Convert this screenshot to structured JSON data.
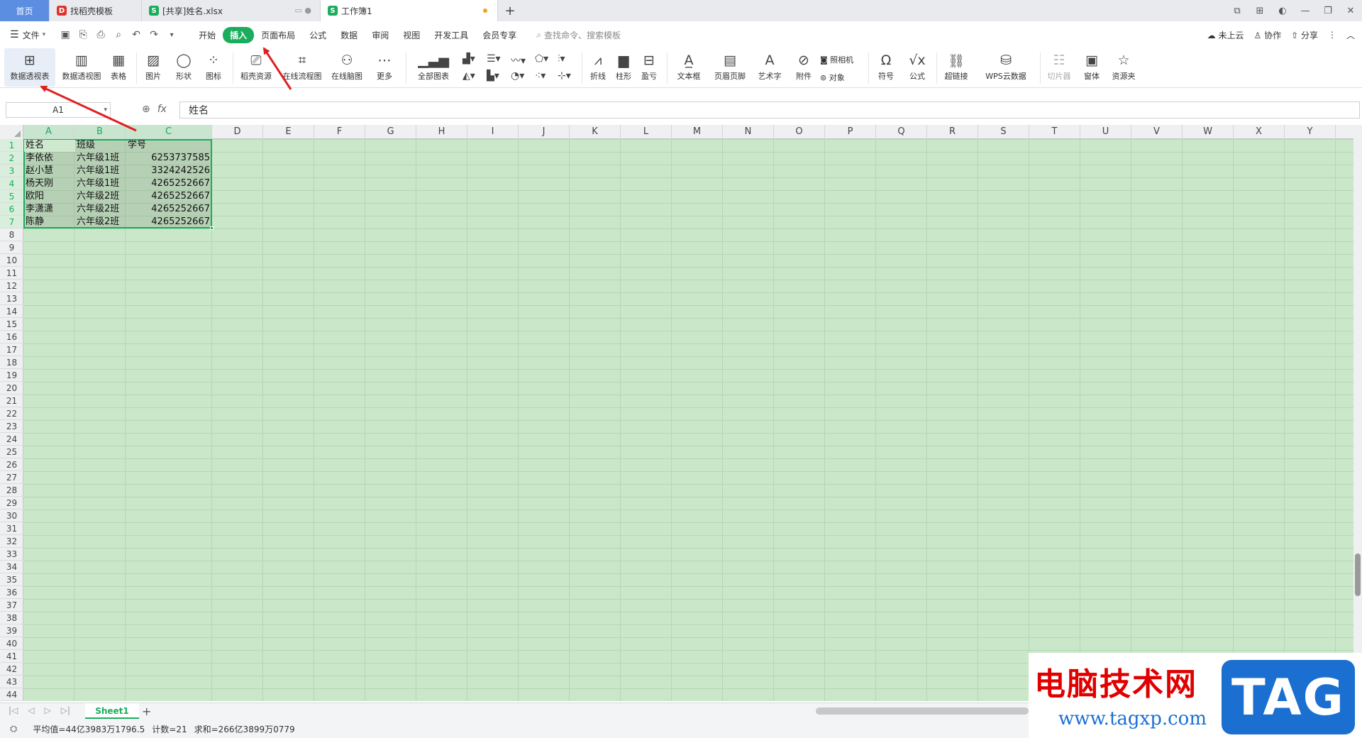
{
  "tabs": {
    "home": "首页",
    "t1": "找稻壳模板",
    "t2": "[共享]姓名.xlsx",
    "t3": "工作簿1",
    "new": "+"
  },
  "window_controls": [
    "⧉",
    "⊞",
    "◐",
    "—",
    "❐",
    "✕"
  ],
  "menubar": {
    "file": "文件",
    "menus": [
      "开始",
      "插入",
      "页面布局",
      "公式",
      "数据",
      "审阅",
      "视图",
      "开发工具",
      "会员专享"
    ],
    "active_menu": "插入",
    "search": "查找命令、搜索模板",
    "cloud": "未上云",
    "collab": "协作",
    "share": "分享"
  },
  "ribbon": {
    "pivot_table": "数据透视表",
    "pivot_chart": "数据透视图",
    "table": "表格",
    "picture": "图片",
    "shape": "形状",
    "icon": "图标",
    "docer": "稻壳资源",
    "flowchart": "在线流程图",
    "mindmap": "在线脑图",
    "more": "更多",
    "all_charts": "全部图表",
    "line": "折线",
    "column": "柱形",
    "winloss": "盈亏",
    "textbox": "文本框",
    "header_footer": "页眉页脚",
    "wordart": "艺术字",
    "attachment": "附件",
    "camera": "照相机",
    "object": "对象",
    "symbol": "符号",
    "formula": "公式",
    "hyperlink": "超链接",
    "wps_cloud": "WPS云数据",
    "slicer": "切片器",
    "window": "窗体",
    "resource": "资源夹"
  },
  "formula_bar": {
    "name_box": "A1",
    "content": "姓名"
  },
  "columns": [
    "A",
    "B",
    "C",
    "D",
    "E",
    "F",
    "G",
    "H",
    "I",
    "J",
    "K",
    "L",
    "M",
    "N",
    "O",
    "P",
    "Q",
    "R",
    "S",
    "T",
    "U",
    "V",
    "W",
    "X",
    "Y"
  ],
  "rows": [
    "1",
    "2",
    "3",
    "4",
    "5",
    "6",
    "7",
    "8",
    "9",
    "10",
    "11",
    "12",
    "13",
    "14",
    "15",
    "16",
    "17",
    "18",
    "19",
    "20",
    "21",
    "22",
    "23",
    "24",
    "25",
    "26",
    "27",
    "28",
    "29",
    "30",
    "31",
    "32",
    "33",
    "34",
    "35",
    "36",
    "37",
    "38",
    "39",
    "40",
    "41",
    "42",
    "43",
    "44"
  ],
  "sheet": {
    "header": [
      "姓名",
      "班级",
      "学号"
    ],
    "data": [
      [
        "李依依",
        "六年级1班",
        "6253737585"
      ],
      [
        "赵小慧",
        "六年级1班",
        "3324242526"
      ],
      [
        "杨天刚",
        "六年级1班",
        "4265252667"
      ],
      [
        "欧阳",
        "六年级2班",
        "4265252667"
      ],
      [
        "李潇潇",
        "六年级2班",
        "4265252667"
      ],
      [
        "陈静",
        "六年级2班",
        "4265252667"
      ]
    ]
  },
  "sheet_tabs": {
    "active": "Sheet1",
    "add": "+"
  },
  "status": {
    "average": "平均值=44亿3983万1796.5",
    "count": "计数=21",
    "sum": "求和=266亿3899万0779"
  },
  "watermark": {
    "title": "电脑技术网",
    "url": "www.tagxp.com",
    "logo": "TAG"
  },
  "colors": {
    "accent": "#1aad5d",
    "grid_bg": "#cbe7ca",
    "arrow": "#e02020",
    "home_tab": "#5b8de0"
  }
}
